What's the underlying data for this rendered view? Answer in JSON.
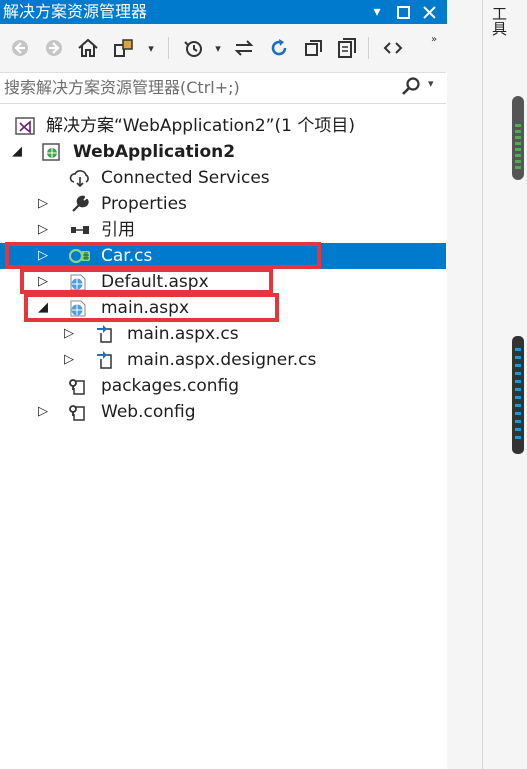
{
  "panel": {
    "title": "解决方案资源管理器",
    "title_buttons": [
      "▾",
      "□",
      "✕"
    ]
  },
  "toolbar": {
    "items": [
      "back-icon",
      "forward-icon",
      "home-icon",
      "switch-views-icon",
      "history-icon",
      "sync-icon",
      "refresh-icon",
      "collapse-all-icon",
      "show-all-files-icon",
      "view-code-icon"
    ]
  },
  "search": {
    "placeholder": "搜索解决方案资源管理器(Ctrl+;)"
  },
  "tree": {
    "solution": "解决方案“WebApplication2”(1 个项目)",
    "project": "WebApplication2",
    "connected_services": "Connected Services",
    "properties": "Properties",
    "references": "引用",
    "car": "Car.cs",
    "default": "Default.aspx",
    "main": "main.aspx",
    "main_cs": "main.aspx.cs",
    "main_designer": "main.aspx.designer.cs",
    "packages": "packages.config",
    "webconfig": "Web.config"
  },
  "right_panel": {
    "tab_label": "工具"
  },
  "colors": {
    "accent": "#007acc",
    "highlight_box": "#e8343d"
  }
}
